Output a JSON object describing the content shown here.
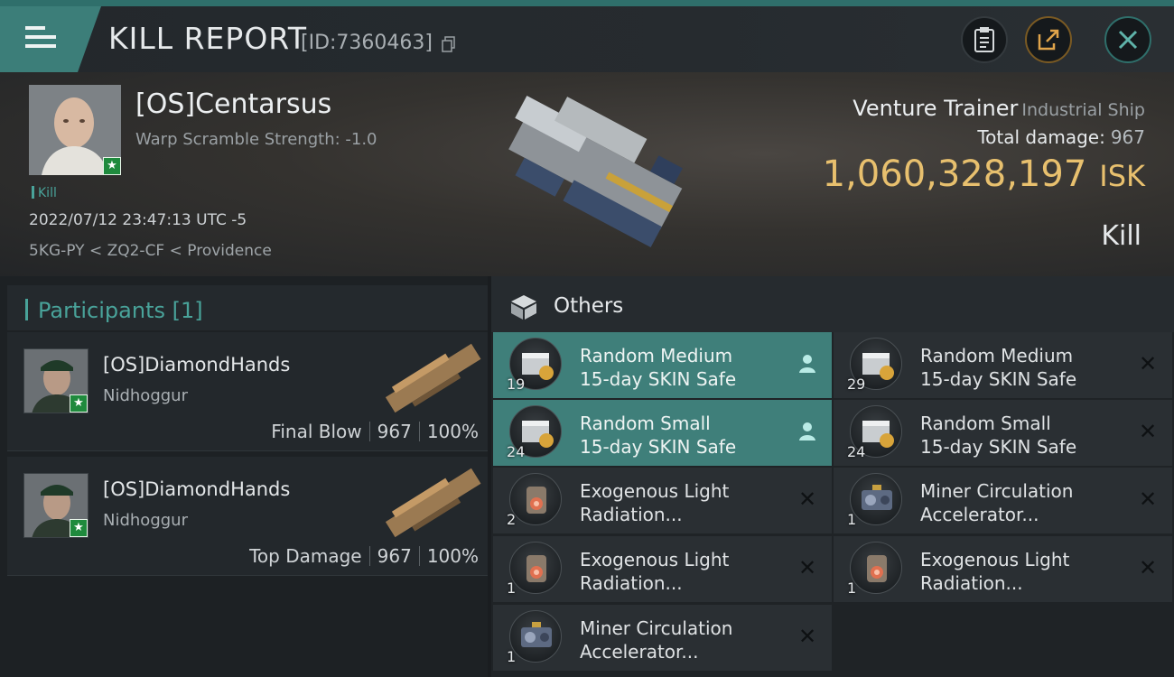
{
  "header": {
    "title": "KILL REPORT",
    "report_id": "[ID:7360463]"
  },
  "victim": {
    "name": "[OS]Centarsus",
    "warp_scramble": "Warp Scramble Strength: -1.0",
    "tag": "Kill",
    "datetime": "2022/07/12 23:47:13 UTC -5",
    "location": "5KG-PY < ZQ2-CF < Providence",
    "ship_name": "Venture Trainer",
    "ship_class": "Industrial Ship",
    "total_damage_label": "Total damage:",
    "total_damage": "967",
    "isk_value": "1,060,328,197",
    "isk_unit": "ISK",
    "result": "Kill"
  },
  "participants": {
    "label": "Participants [1]",
    "rows": [
      {
        "name": "[OS]DiamondHands",
        "ship": "Nidhoggur",
        "role": "Final Blow",
        "damage": "967",
        "percent": "100%"
      },
      {
        "name": "[OS]DiamondHands",
        "ship": "Nidhoggur",
        "role": "Top Damage",
        "damage": "967",
        "percent": "100%"
      }
    ]
  },
  "others": {
    "label": "Others",
    "items": [
      {
        "line1": "Random Medium",
        "line2": "15-day SKIN Safe",
        "qty": "19",
        "icon": "skin-safe-icon",
        "status": "collected"
      },
      {
        "line1": "Random Medium",
        "line2": "15-day SKIN Safe",
        "qty": "29",
        "icon": "skin-safe-icon",
        "status": "destroyed"
      },
      {
        "line1": "Random Small",
        "line2": "15-day SKIN Safe",
        "qty": "24",
        "icon": "skin-safe-icon",
        "status": "collected"
      },
      {
        "line1": "Random Small",
        "line2": "15-day SKIN Safe",
        "qty": "24",
        "icon": "skin-safe-icon",
        "status": "destroyed"
      },
      {
        "line1": "Exogenous Light",
        "line2": "Radiation...",
        "qty": "2",
        "icon": "radiation-module-icon",
        "status": "destroyed"
      },
      {
        "line1": "Miner Circulation",
        "line2": "Accelerator...",
        "qty": "1",
        "icon": "miner-accelerator-icon",
        "status": "destroyed"
      },
      {
        "line1": "Exogenous Light",
        "line2": "Radiation...",
        "qty": "1",
        "icon": "radiation-module-icon",
        "status": "destroyed"
      },
      {
        "line1": "Exogenous Light",
        "line2": "Radiation...",
        "qty": "1",
        "icon": "radiation-module-icon",
        "status": "destroyed"
      },
      {
        "line1": "Miner Circulation",
        "line2": "Accelerator...",
        "qty": "1",
        "icon": "miner-accelerator-icon",
        "status": "destroyed"
      }
    ]
  },
  "colors": {
    "accent_teal": "#49a39a",
    "highlight_row": "#3f7f7a",
    "isk_gold": "#e8c06e"
  }
}
